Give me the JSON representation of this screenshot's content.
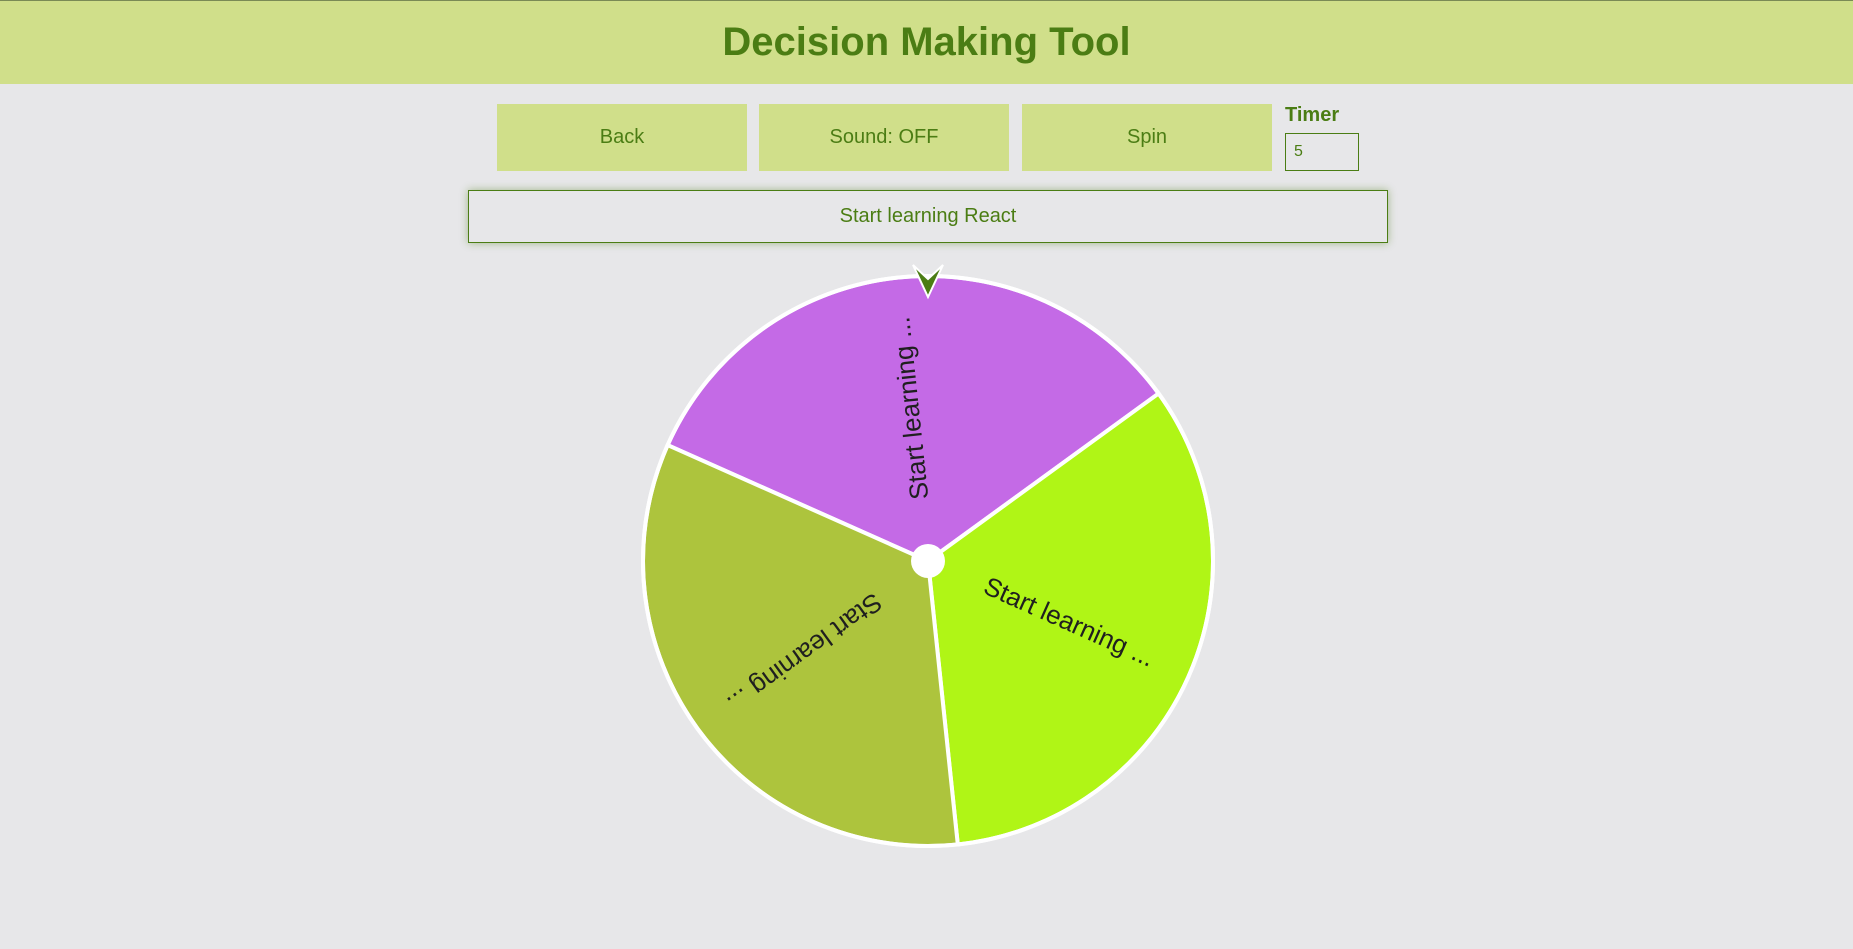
{
  "header": {
    "title": "Decision Making Tool"
  },
  "toolbar": {
    "back_label": "Back",
    "sound_label": "Sound: OFF",
    "spin_label": "Spin",
    "timer_label": "Timer",
    "timer_value": "5"
  },
  "result": {
    "text": "Start learning React"
  },
  "wheel": {
    "segments": [
      {
        "label": "Start learning ...",
        "color": "#c46ae6"
      },
      {
        "label": "Start learning ...",
        "color": "#b0f516"
      },
      {
        "label": "Start learning ...",
        "color": "#adc43d"
      }
    ],
    "pointer_color": "#4b7d14"
  }
}
